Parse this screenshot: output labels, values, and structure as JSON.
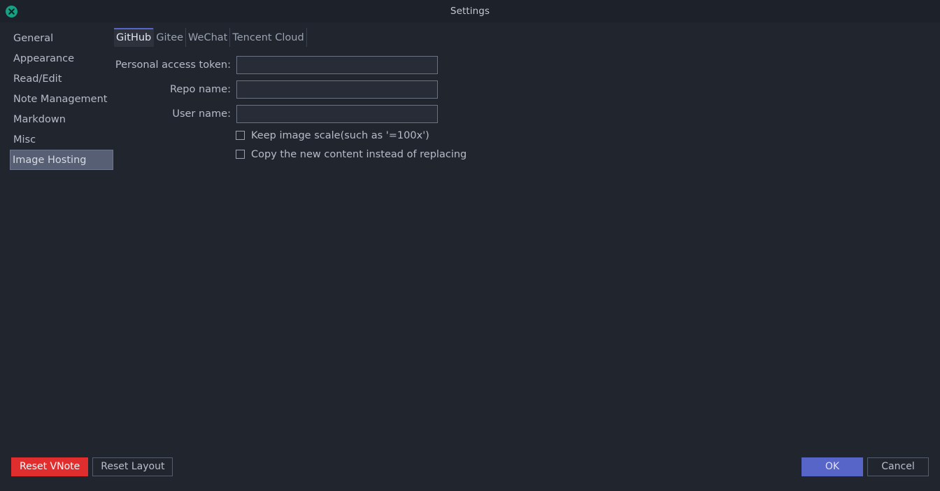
{
  "window": {
    "title": "Settings",
    "close_icon": "close-circle-icon",
    "accent_color": "#5865c8",
    "danger_color": "#e02d2d",
    "close_button_color": "#16a085",
    "background_color": "#21252e",
    "selected_item_color": "#565f73"
  },
  "sidebar": {
    "items": [
      {
        "label": "General",
        "selected": false
      },
      {
        "label": "Appearance",
        "selected": false
      },
      {
        "label": "Read/Edit",
        "selected": false
      },
      {
        "label": "Note Management",
        "selected": false
      },
      {
        "label": "Markdown",
        "selected": false
      },
      {
        "label": "Misc",
        "selected": false
      },
      {
        "label": "Image Hosting",
        "selected": true
      }
    ]
  },
  "tabs": [
    {
      "label": "GitHub",
      "active": true
    },
    {
      "label": "Gitee",
      "active": false
    },
    {
      "label": "WeChat",
      "active": false
    },
    {
      "label": "Tencent Cloud",
      "active": false
    }
  ],
  "form": {
    "fields": [
      {
        "label": "Personal access token:",
        "value": "",
        "placeholder": ""
      },
      {
        "label": "Repo name:",
        "value": "",
        "placeholder": ""
      },
      {
        "label": "User name:",
        "value": "",
        "placeholder": ""
      }
    ],
    "checkboxes": [
      {
        "label": "Keep image scale(such as '=100x')",
        "checked": false
      },
      {
        "label": "Copy the new content instead of replacing",
        "checked": false
      }
    ]
  },
  "footer": {
    "reset_vnote_label": "Reset VNote",
    "reset_layout_label": "Reset Layout",
    "ok_label": "OK",
    "cancel_label": "Cancel"
  }
}
